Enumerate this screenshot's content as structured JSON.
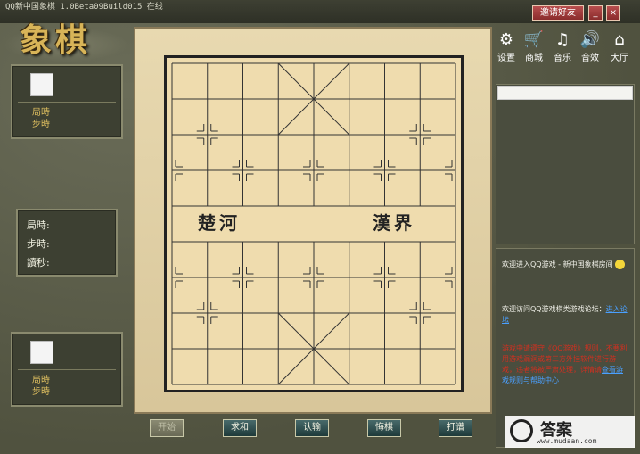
{
  "window": {
    "title": "QQ新中国象棋 1.0Beta09Build015 在线",
    "invite_label": "邀请好友",
    "minimize_label": "_",
    "close_label": "×"
  },
  "logo_text": "象棋",
  "toolbar": [
    {
      "label": "设置",
      "icon": "gear-icon",
      "glyph": "⚙"
    },
    {
      "label": "商城",
      "icon": "cart-icon",
      "glyph": "🛒"
    },
    {
      "label": "音乐",
      "icon": "music-icon",
      "glyph": "♫"
    },
    {
      "label": "音效",
      "icon": "speaker-icon",
      "glyph": "🔊"
    },
    {
      "label": "大厅",
      "icon": "home-icon",
      "glyph": "⌂"
    }
  ],
  "top_player": {
    "game_time_label": "局時",
    "step_time_label": "步時"
  },
  "middle_panel": {
    "game_time_label": "局時:",
    "step_time_label": "步時:",
    "countdown_label": "讀秒:"
  },
  "bottom_player": {
    "game_time_label": "局時",
    "step_time_label": "步時"
  },
  "board": {
    "river_left": "楚河",
    "river_right": "漢界"
  },
  "buttons": {
    "start": "开始",
    "draw": "求和",
    "resign": "认输",
    "undo": "悔棋",
    "save": "打谱"
  },
  "chat": {
    "line1": "欢迎进入QQ游戏 - 新中国象棋房间",
    "line2_prefix": "欢迎访问QQ游戏棋类游戏论坛：",
    "line2_link": "进入",
    "line2_tail": "论坛",
    "line3": "游戏中请遵守《QQ游戏》规则，不要利用游戏漏洞或第三方外挂软件进行游戏，违者将被严肃处理，详情请",
    "line3_link": "查看游戏规则与帮助中心"
  },
  "watermark": {
    "big": "答案",
    "small": "www.mudaan.com"
  }
}
